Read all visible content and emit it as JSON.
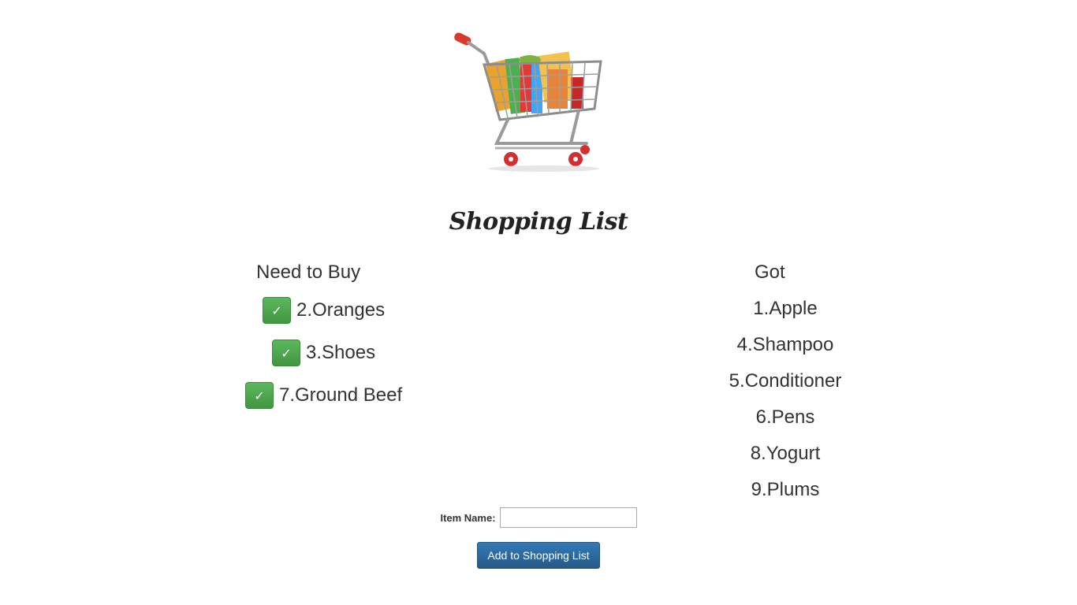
{
  "header": {
    "title": "Shopping List"
  },
  "need_column": {
    "heading": "Need to Buy",
    "check_symbol": "✓",
    "items": [
      {
        "label": "2.Oranges"
      },
      {
        "label": "3.Shoes"
      },
      {
        "label": "7.Ground Beef"
      }
    ]
  },
  "got_column": {
    "heading": "Got",
    "items": [
      {
        "label": "1.Apple"
      },
      {
        "label": "4.Shampoo"
      },
      {
        "label": "5.Conditioner"
      },
      {
        "label": "6.Pens"
      },
      {
        "label": "8.Yogurt"
      },
      {
        "label": "9.Plums"
      }
    ]
  },
  "form": {
    "item_name_label": "Item Name:",
    "item_name_value": "",
    "item_name_placeholder": "",
    "add_button_label": "Add to Shopping List"
  },
  "colors": {
    "check_button": "#5cb85c",
    "add_button": "#337ab7"
  },
  "icons": {
    "cart": "shopping-cart-icon",
    "check": "check-icon"
  }
}
